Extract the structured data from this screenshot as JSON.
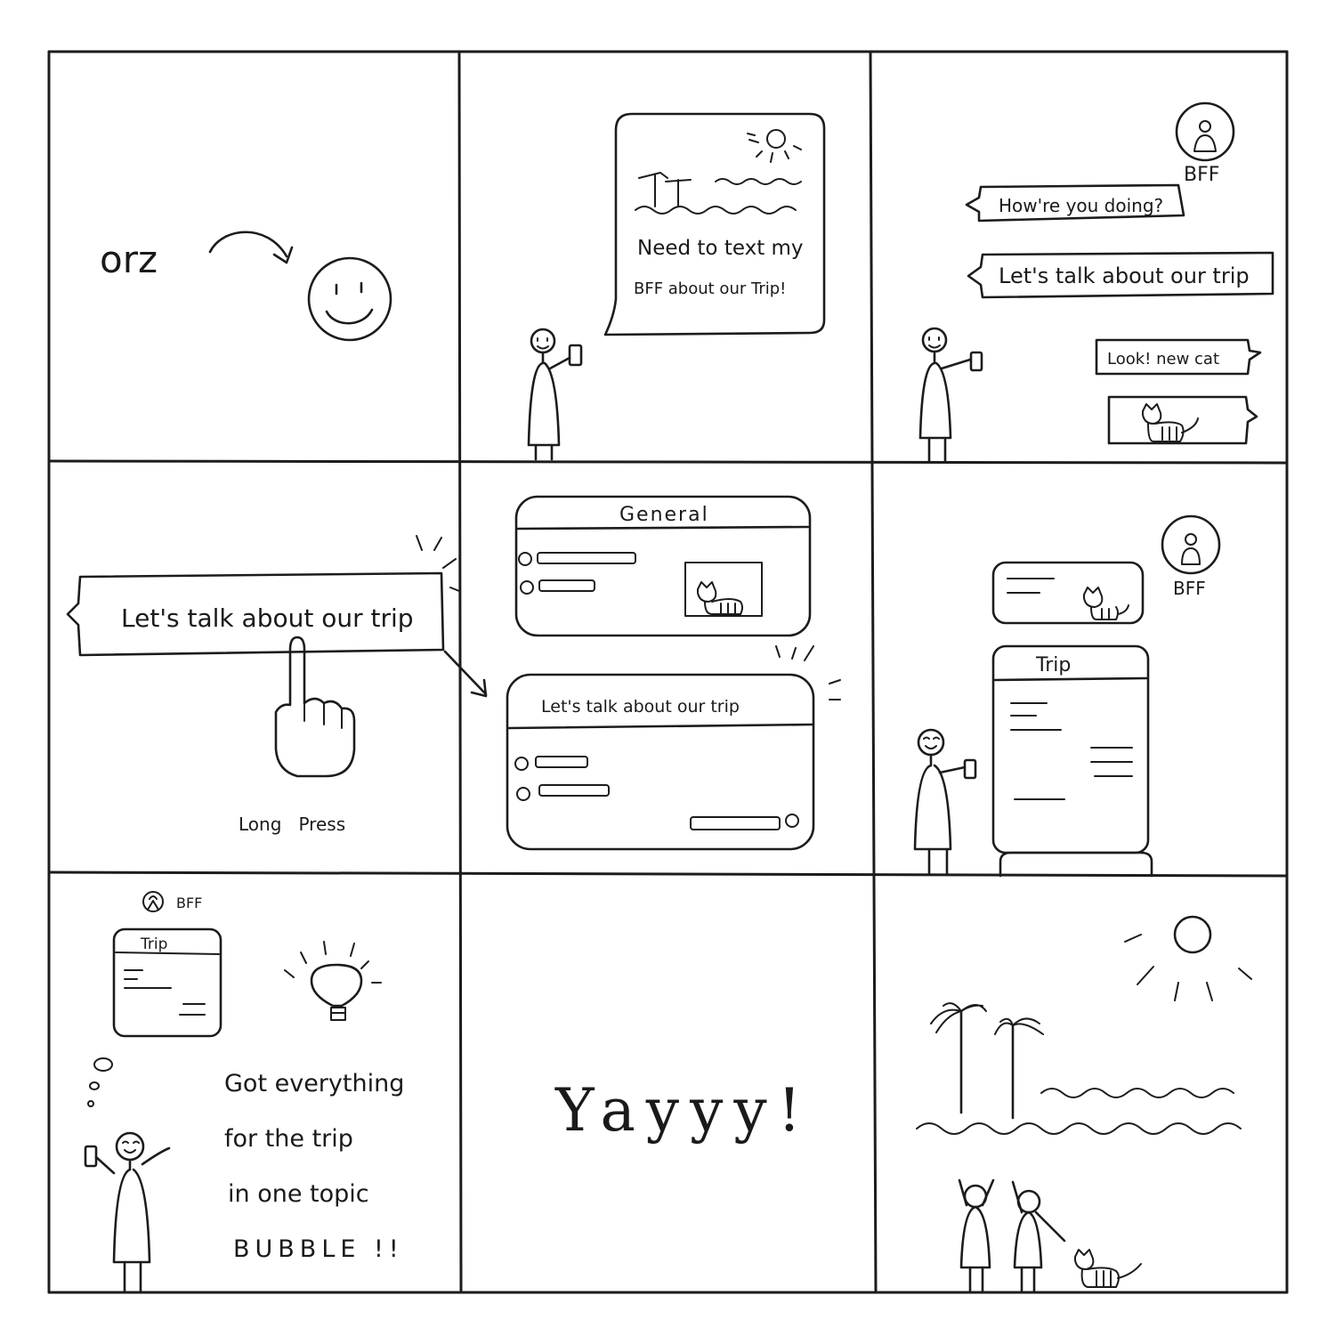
{
  "panel1": {
    "emoticon": "orz"
  },
  "panel2": {
    "speech_line1": "Need to text my",
    "speech_line2": "BFF about our Trip!"
  },
  "panel3": {
    "contact_label": "BFF",
    "msg_incoming": "How're you doing?",
    "msg_trip": "Let's talk about our trip",
    "msg_cat": "Look! new cat"
  },
  "panel4": {
    "message": "Let's talk about our trip",
    "gesture_caption": "Long   Press"
  },
  "panel5": {
    "general_title": "General",
    "topic_title": "Let's talk about our trip"
  },
  "panel6": {
    "contact_label": "BFF",
    "topic_title": "Trip"
  },
  "panel7": {
    "contact_label": "BFF",
    "topic_title": "Trip",
    "caption_line1": "Got everything",
    "caption_line2": "for the trip",
    "caption_line3": "in one topic",
    "caption_line4": "BUBBLE !!"
  },
  "panel8": {
    "exclamation": "Yayyy!"
  }
}
